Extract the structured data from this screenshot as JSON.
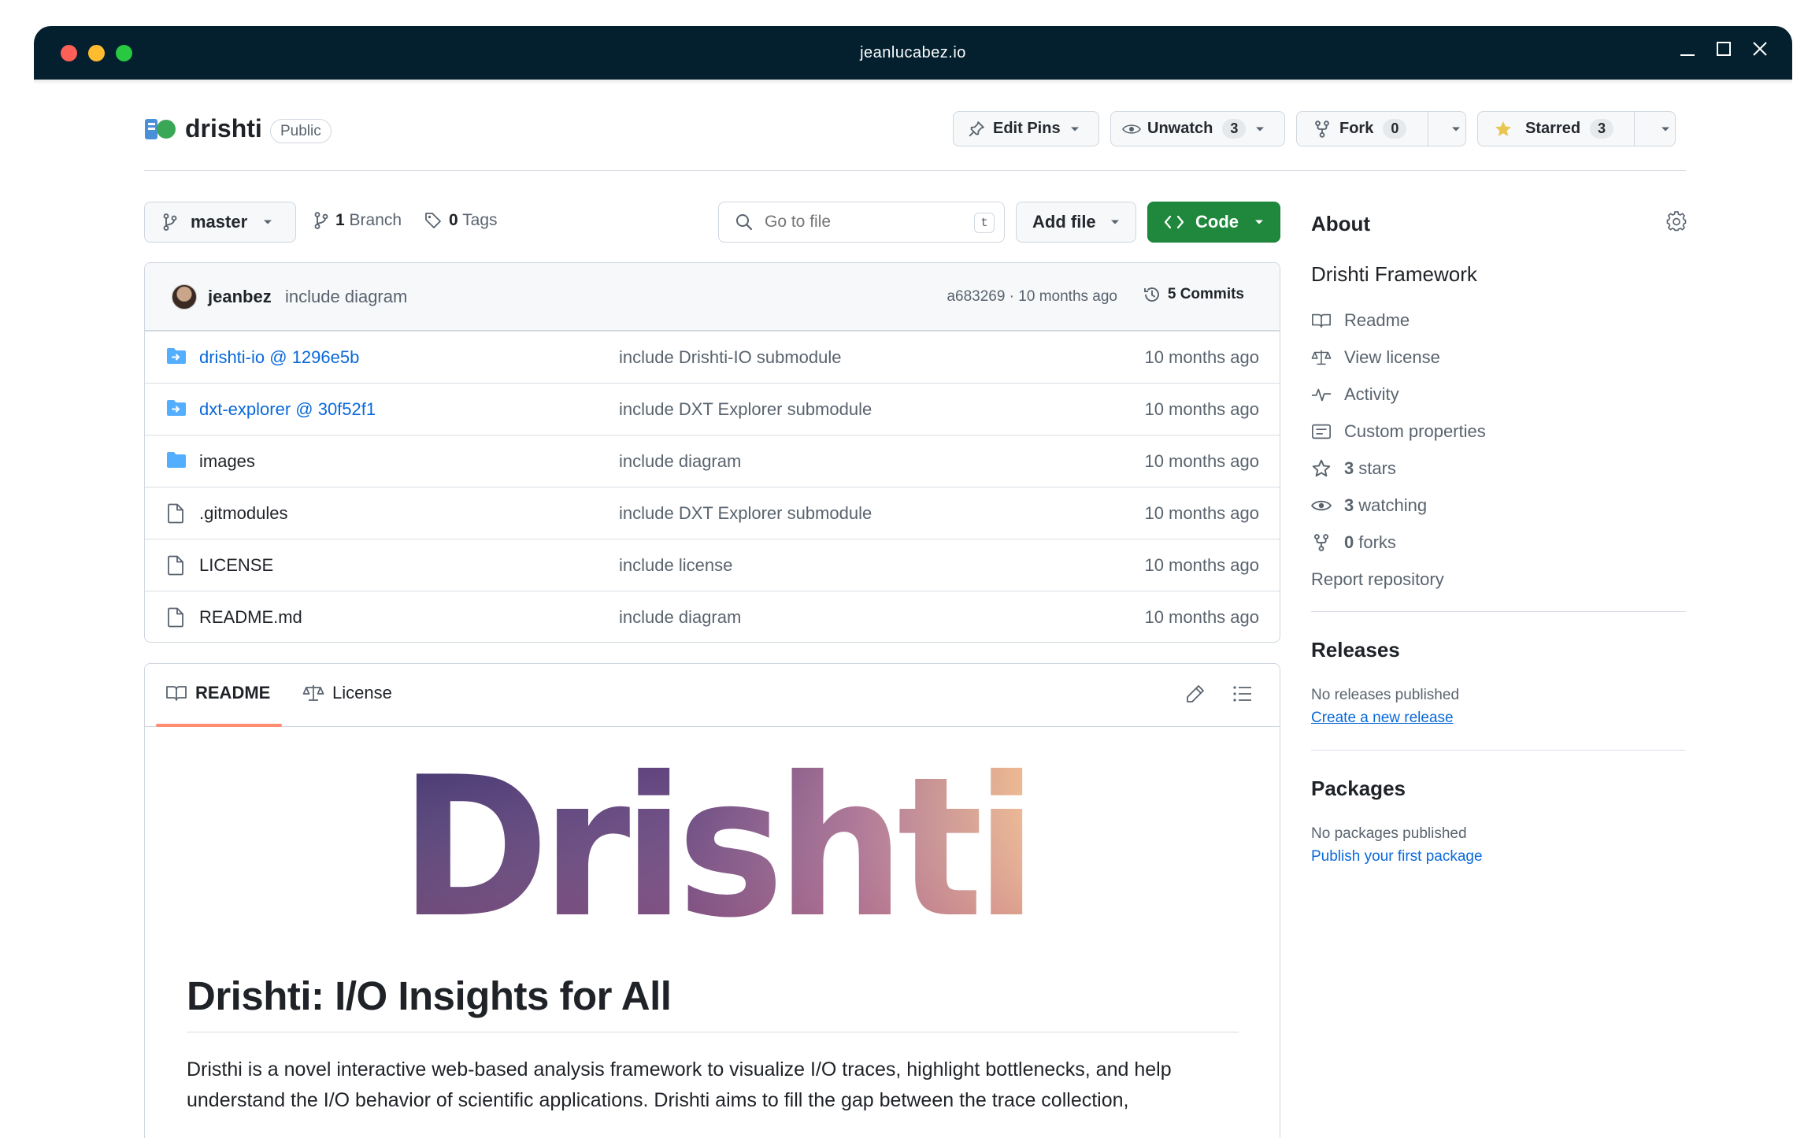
{
  "window": {
    "title": "jeanlucabez.io"
  },
  "repo": {
    "name": "drishti",
    "visibility": "Public",
    "actions": {
      "edit_pins": "Edit Pins",
      "unwatch": "Unwatch",
      "watch_count": "3",
      "fork": "Fork",
      "fork_count": "0",
      "starred": "Starred",
      "star_count": "3"
    }
  },
  "file_nav": {
    "branch": "master",
    "branch_count": "1",
    "branch_label": "Branch",
    "tag_count": "0",
    "tag_label": "Tags",
    "search_placeholder": "Go to file",
    "search_shortcut": "t",
    "add_file": "Add file",
    "code": "Code"
  },
  "latest_commit": {
    "author": "jeanbez",
    "message": "include diagram",
    "hash_time": "a683269 · 10 months ago",
    "commits_label": "5 Commits"
  },
  "files": [
    {
      "name": "drishti-io @ 1296e5b",
      "type": "submodule",
      "message": "include Drishti-IO submodule",
      "date": "10 months ago"
    },
    {
      "name": "dxt-explorer @ 30f52f1",
      "type": "submodule",
      "message": "include DXT Explorer submodule",
      "date": "10 months ago"
    },
    {
      "name": "images",
      "type": "folder",
      "message": "include diagram",
      "date": "10 months ago"
    },
    {
      "name": ".gitmodules",
      "type": "file",
      "message": "include DXT Explorer submodule",
      "date": "10 months ago"
    },
    {
      "name": "LICENSE",
      "type": "file",
      "message": "include license",
      "date": "10 months ago"
    },
    {
      "name": "README.md",
      "type": "file",
      "message": "include diagram",
      "date": "10 months ago"
    }
  ],
  "readme": {
    "tabs": [
      "README",
      "License"
    ],
    "banner_text": "Drishti",
    "heading": "Drishti: I/O Insights for All",
    "paragraph": "Dristhi is a novel interactive web-based analysis framework to visualize I/O traces, highlight bottlenecks, and help understand the I/O behavior of scientific applications. Drishti aims to fill the gap between the trace collection,"
  },
  "about": {
    "title": "About",
    "description": "Drishti Framework",
    "items": [
      {
        "icon": "book-icon",
        "label": "Readme",
        "count": ""
      },
      {
        "icon": "scale-icon",
        "label": "View license",
        "count": ""
      },
      {
        "icon": "pulse-icon",
        "label": "Activity",
        "count": ""
      },
      {
        "icon": "note-icon",
        "label": "Custom properties",
        "count": ""
      },
      {
        "icon": "star-icon",
        "label": "stars",
        "count": "3"
      },
      {
        "icon": "eye-icon",
        "label": "watching",
        "count": "3"
      },
      {
        "icon": "fork-icon",
        "label": "forks",
        "count": "0"
      }
    ],
    "report": "Report repository"
  },
  "releases": {
    "title": "Releases",
    "empty": "No releases published",
    "link": "Create a new release"
  },
  "packages": {
    "title": "Packages",
    "empty": "No packages published",
    "link": "Publish your first package"
  },
  "colors": {
    "titlebar": "#04202f",
    "accent_green": "#1f883d",
    "link_blue": "#0969da",
    "tab_underline": "#fd8c73"
  }
}
